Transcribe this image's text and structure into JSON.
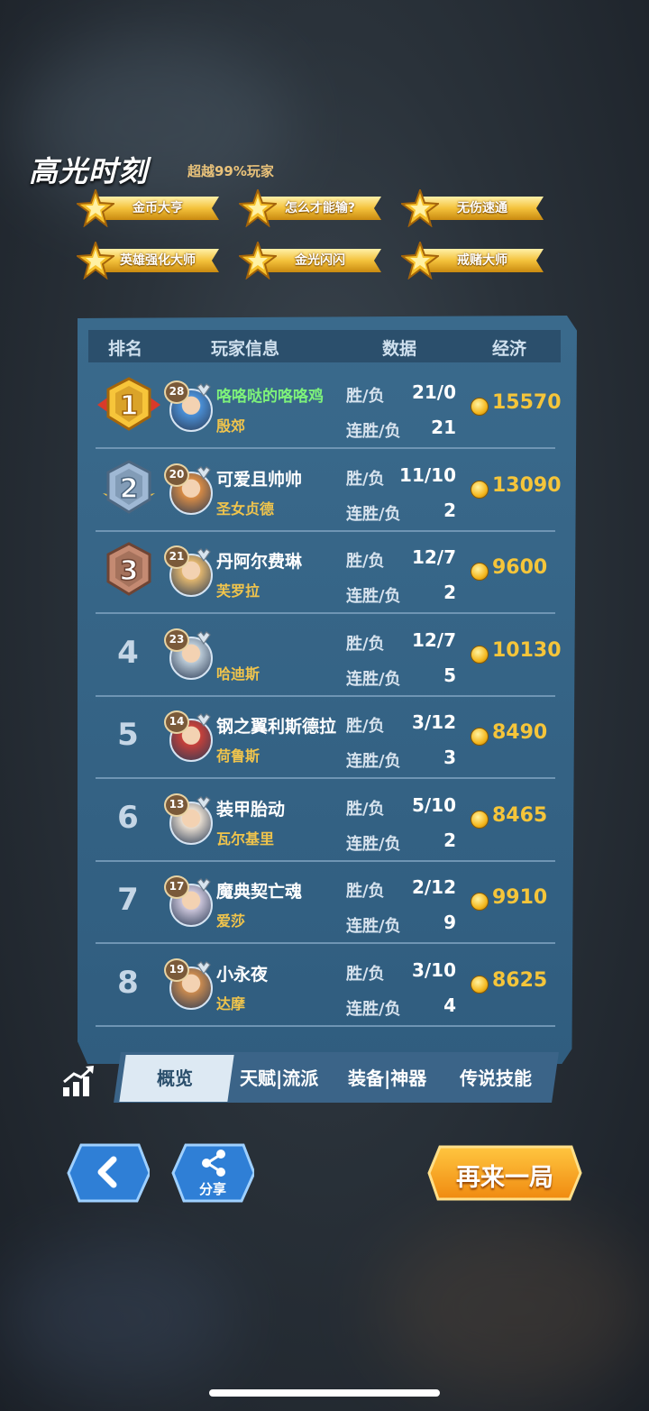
{
  "highlight": {
    "title": "高光时刻",
    "subtitle": "超越99%玩家",
    "badges": [
      "金币大亨",
      "怎么才能输?",
      "无伤速通",
      "英雄强化大师",
      "金光闪闪",
      "戒赌大师"
    ]
  },
  "table": {
    "headers": [
      "排名",
      "玩家信息",
      "数据",
      "经济"
    ],
    "stat_labels": {
      "win_loss": "胜/负",
      "streak": "连胜/负"
    },
    "rows": [
      {
        "rank": "1",
        "level": "28",
        "name": "咯咯哒的咯咯鸡",
        "hero": "殷郊",
        "win_loss": "21/0",
        "streak": "21",
        "gold": "15570"
      },
      {
        "rank": "2",
        "level": "20",
        "name": "可爱且帅帅",
        "hero": "圣女贞德",
        "win_loss": "11/10",
        "streak": "2",
        "gold": "13090"
      },
      {
        "rank": "3",
        "level": "21",
        "name": "丹阿尔费琳",
        "hero": "芙罗拉",
        "win_loss": "12/7",
        "streak": "2",
        "gold": "9600"
      },
      {
        "rank": "4",
        "level": "23",
        "name": "",
        "hero": "哈迪斯",
        "win_loss": "12/7",
        "streak": "5",
        "gold": "10130"
      },
      {
        "rank": "5",
        "level": "14",
        "name": "钢之翼利斯德拉",
        "hero": "荷鲁斯",
        "win_loss": "3/12",
        "streak": "3",
        "gold": "8490"
      },
      {
        "rank": "6",
        "level": "13",
        "name": "装甲胎动",
        "hero": "瓦尔基里",
        "win_loss": "5/10",
        "streak": "2",
        "gold": "8465"
      },
      {
        "rank": "7",
        "level": "17",
        "name": "魔典契亡魂",
        "hero": "爱莎",
        "win_loss": "2/12",
        "streak": "9",
        "gold": "9910"
      },
      {
        "rank": "8",
        "level": "19",
        "name": "小永夜",
        "hero": "达摩",
        "win_loss": "3/10",
        "streak": "4",
        "gold": "8625"
      }
    ]
  },
  "tabs": [
    "概览",
    "天赋|流派",
    "装备|神器",
    "传说技能"
  ],
  "active_tab": "概览",
  "buttons": {
    "back_icon": "chevron-left-icon",
    "share_label": "分享",
    "play_again_label": "再来一局"
  },
  "colors": {
    "gold": "#f5c53a",
    "highlight_name": "#7ef27a",
    "hero_name": "#f0c44c",
    "panel": "#3a6a8c",
    "play_again": "#f6a21c"
  }
}
